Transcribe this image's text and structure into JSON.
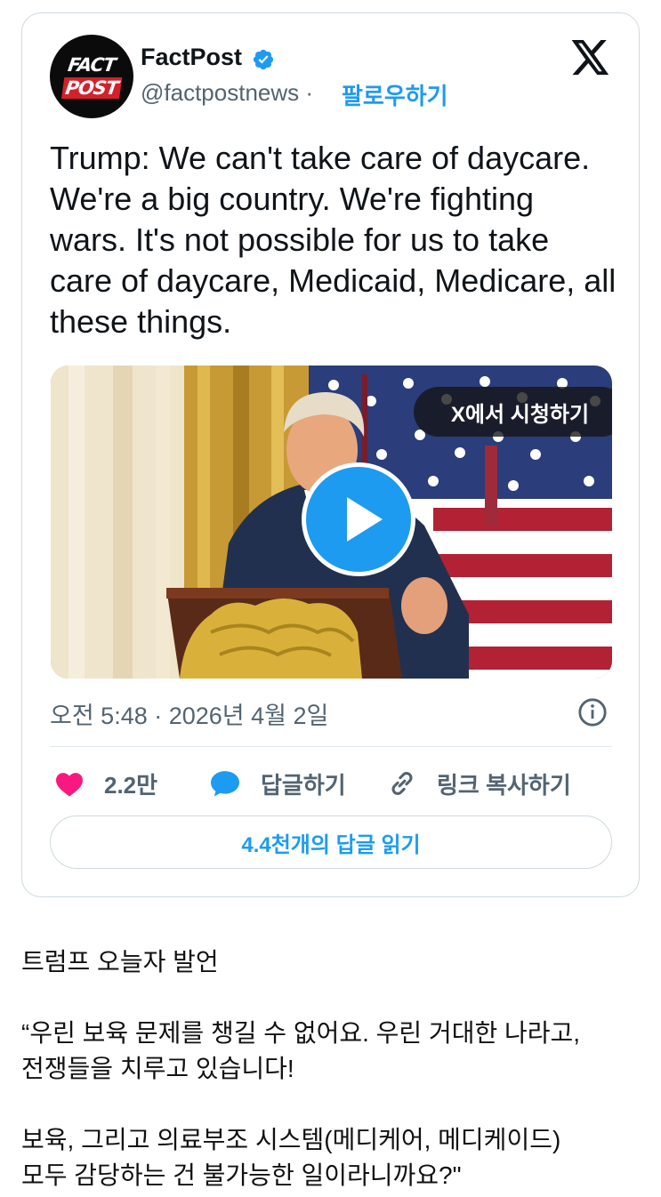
{
  "tweet": {
    "author_name": "FactPost",
    "author_handle": "@factpostnews",
    "separator": "·",
    "follow_label": "팔로우하기",
    "avatar_line1": "FACT",
    "avatar_line2": "POST",
    "text": "Trump: We can't take care of daycare. We're a big country. We're fighting wars. It's not possible for us to take care of daycare, Medicaid, Medicare, all these things.",
    "media": {
      "watch_label": "X에서 시청하기"
    },
    "timestamp": "오전 5:48 · 2026년 4월 2일",
    "actions": {
      "like_count": "2.2만",
      "reply_label": "답글하기",
      "copy_link_label": "링크 복사하기"
    },
    "read_replies_label": "4.4천개의 답글 읽기"
  },
  "post": {
    "line1": "트럼프 오늘자 발언",
    "line2": "“우린 보육 문제를 챙길 수 없어요. 우린 거대한 나라고,",
    "line3": "전쟁들을 치루고 있습니다!",
    "line4": "보육, 그리고 의료부조 시스템(메디케어, 메디케이드)",
    "line5": "모두 감당하는 건 불가능한 일이라니까요?\""
  },
  "colors": {
    "accent": "#1d9bf0",
    "like": "#f91880",
    "muted": "#536471"
  }
}
